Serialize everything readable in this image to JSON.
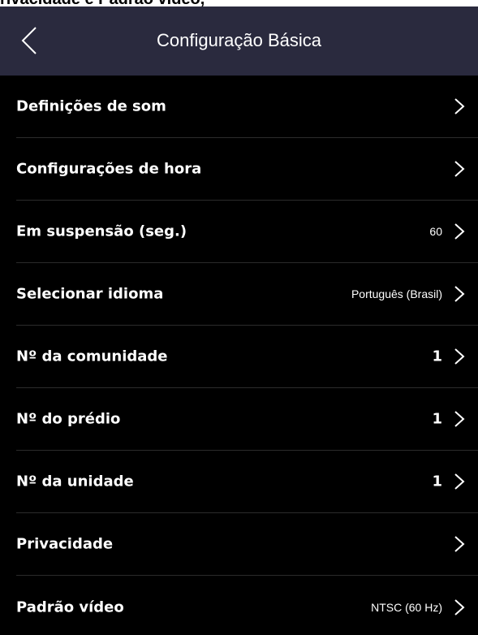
{
  "caption": "rivacidade e Padrão vídeo,",
  "header": {
    "title": "Configuração Básica",
    "background": "#2a2a3e"
  },
  "icons": {
    "back": "chevron-left-icon",
    "row": "chevron-right-icon"
  },
  "rows": [
    {
      "label": "Definições de som",
      "value": ""
    },
    {
      "label": "Configurações de hora",
      "value": ""
    },
    {
      "label": "Em suspensão (seg.)",
      "value": "60"
    },
    {
      "label": "Selecionar idioma",
      "value": "Português (Brasil)"
    },
    {
      "label": "Nº da comunidade",
      "value": "1"
    },
    {
      "label": "Nº do prédio",
      "value": "1"
    },
    {
      "label": "Nº da unidade",
      "value": "1"
    },
    {
      "label": "Privacidade",
      "value": ""
    },
    {
      "label": "Padrão vídeo",
      "value": "NTSC (60 Hz)"
    }
  ]
}
